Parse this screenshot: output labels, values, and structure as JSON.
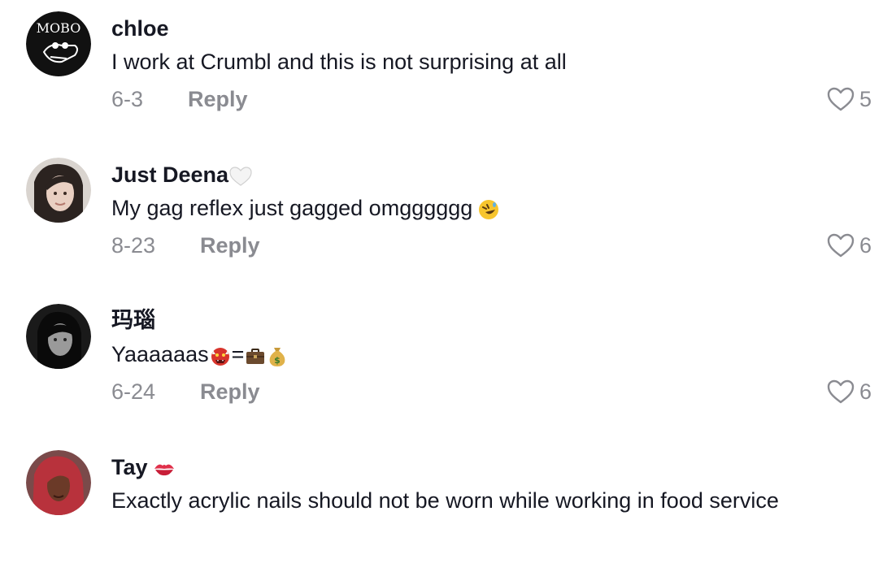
{
  "comments": [
    {
      "username": "chloe",
      "text": "I work at Crumbl and this is not surprising at all",
      "date": "6-3",
      "reply_label": "Reply",
      "likes": "5",
      "avatar_text": "MOBO"
    },
    {
      "username": "Just Deena",
      "username_emoji": "white-heart-emoji",
      "text": "My gag reflex just gagged omgggggg",
      "text_emoji": "rolling-on-floor-laughing-emoji",
      "date": "8-23",
      "reply_label": "Reply",
      "likes": "6"
    },
    {
      "username": "玛瑙",
      "text_prefix": "Yaaaaaas",
      "text_eq": "=",
      "text_emojis": [
        "ogre-emoji",
        "briefcase-emoji",
        "money-bag-emoji"
      ],
      "date": "6-24",
      "reply_label": "Reply",
      "likes": "6"
    },
    {
      "username": "Tay",
      "username_emoji": "kiss-mark-emoji",
      "text": "Exactly acrylic nails should not be worn while working in food service",
      "date": "",
      "reply_label": "",
      "likes": ""
    }
  ],
  "colors": {
    "text": "#161823",
    "muted": "#8a8b91"
  }
}
